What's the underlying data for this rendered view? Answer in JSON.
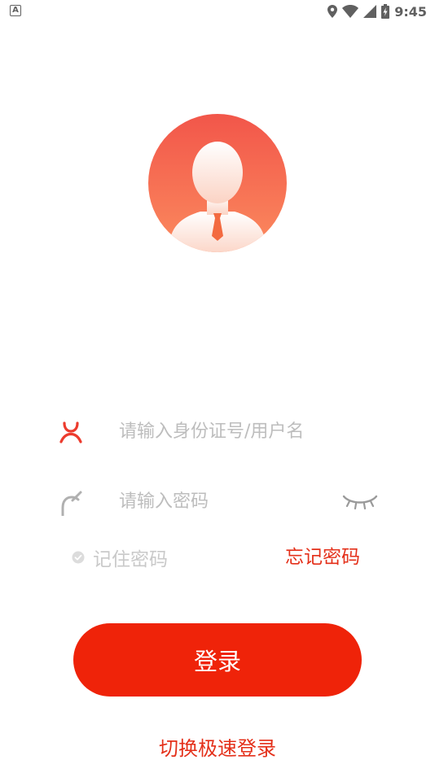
{
  "status_bar": {
    "notification_badge": "A",
    "time": "9:45",
    "icons": [
      "location-icon",
      "wifi-icon",
      "signal-icon",
      "battery-charging-icon"
    ]
  },
  "avatar": {
    "icon": "user-avatar-icon"
  },
  "login_form": {
    "username": {
      "icon": "user-icon",
      "value": "",
      "placeholder": "请输入身份证号/用户名"
    },
    "password": {
      "icon": "lock-icon",
      "value": "",
      "placeholder": "请输入密码",
      "toggle_icon": "eye-closed-icon"
    },
    "remember_label": "记住密码",
    "forgot_label": "忘记密码",
    "submit_label": "登录",
    "switch_label": "切换极速登录"
  },
  "colors": {
    "primary": "#ef2309",
    "accent_text": "#e4301a",
    "placeholder": "#bdbdbd",
    "muted": "#c9c9c9"
  }
}
